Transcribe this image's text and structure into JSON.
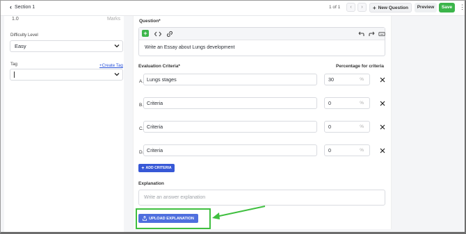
{
  "topbar": {
    "back_label": "Section 1",
    "pager_text": "1 of 1",
    "prev_label": "‹",
    "next_label": "›",
    "new_question_label": "New Question",
    "preview_label": "Preview",
    "save_label": "Save",
    "kebab_label": "⋮"
  },
  "sidebar": {
    "marks_value": "1.0",
    "marks_unit": "Marks",
    "difficulty_label": "Difficulty Level",
    "difficulty_value": "Easy",
    "tag_label": "Tag",
    "create_tag_label": "+Create Tag",
    "tag_value": ""
  },
  "question": {
    "label": "Question*",
    "text": "Write an Essay about Lungs development"
  },
  "criteria": {
    "label": "Evaluation Criteria*",
    "percentage_label": "Percentage for criteria",
    "items": [
      {
        "letter": "A.",
        "value": "Lungs stages",
        "percent": "30",
        "pct_symbol": "%"
      },
      {
        "letter": "B.",
        "value": "Criteria",
        "percent": "0",
        "pct_symbol": "%"
      },
      {
        "letter": "C.",
        "value": "Criteria",
        "percent": "0",
        "pct_symbol": "%"
      },
      {
        "letter": "D.",
        "value": "Criteria",
        "percent": "0",
        "pct_symbol": "%"
      }
    ],
    "add_label": "ADD CRITERIA"
  },
  "explanation": {
    "label": "Explanation",
    "placeholder": "Write an answer explanation",
    "upload_label": "UPLOAD EXPLANATION"
  },
  "colors": {
    "save_green": "#3bb54a",
    "primary_blue": "#3758d6",
    "highlight_green": "#3fbf3f"
  }
}
